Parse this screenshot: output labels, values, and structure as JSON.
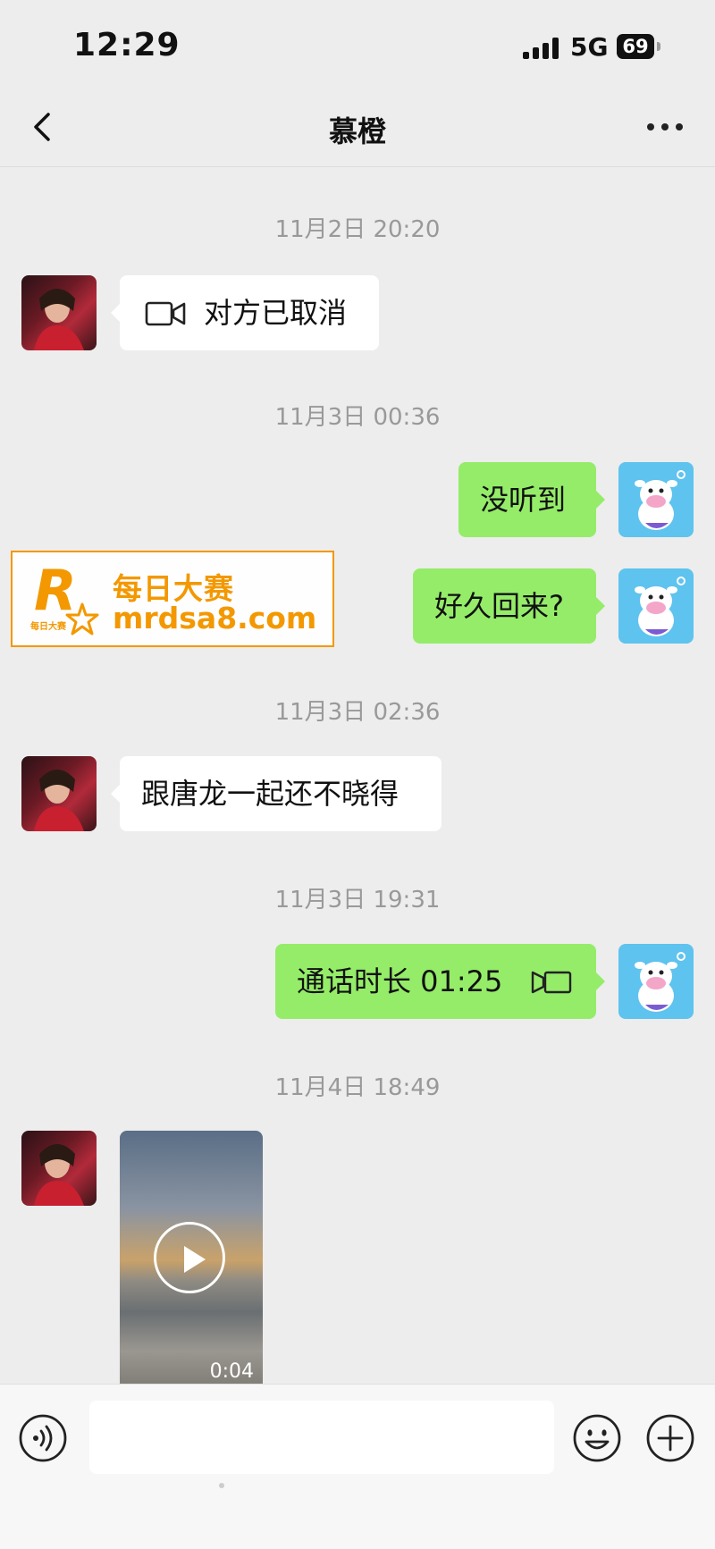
{
  "status_bar": {
    "time": "12:29",
    "network": "5G",
    "battery": "69"
  },
  "header": {
    "title": "慕橙"
  },
  "messages": [
    {
      "type": "timestamp",
      "text": "11月2日 20:20"
    },
    {
      "type": "call",
      "from": "contact",
      "icon": "video-camera-icon",
      "text": "对方已取消"
    },
    {
      "type": "timestamp",
      "text": "11月3日 00:36"
    },
    {
      "type": "text",
      "from": "me",
      "text": "没听到"
    },
    {
      "type": "text",
      "from": "me",
      "text": "好久回来?"
    },
    {
      "type": "timestamp",
      "text": "11月3日 02:36"
    },
    {
      "type": "text",
      "from": "contact",
      "text": "跟唐龙一起还不晓得"
    },
    {
      "type": "timestamp",
      "text": "11月3日 19:31"
    },
    {
      "type": "call",
      "from": "me",
      "icon": "video-camera-icon",
      "text": "通话时长 01:25"
    },
    {
      "type": "timestamp",
      "text": "11月4日 18:49"
    },
    {
      "type": "video",
      "from": "contact",
      "duration": "0:04"
    }
  ],
  "watermark": {
    "logo_letter": "R",
    "logo_text": "每日大赛",
    "name": "每日大赛",
    "url": "mrdsa8.com"
  },
  "input_bar": {
    "placeholder": ""
  },
  "colors": {
    "outgoing_bubble": "#95ec69",
    "incoming_bubble": "#ffffff",
    "background": "#ededed",
    "watermark": "#f39800"
  }
}
